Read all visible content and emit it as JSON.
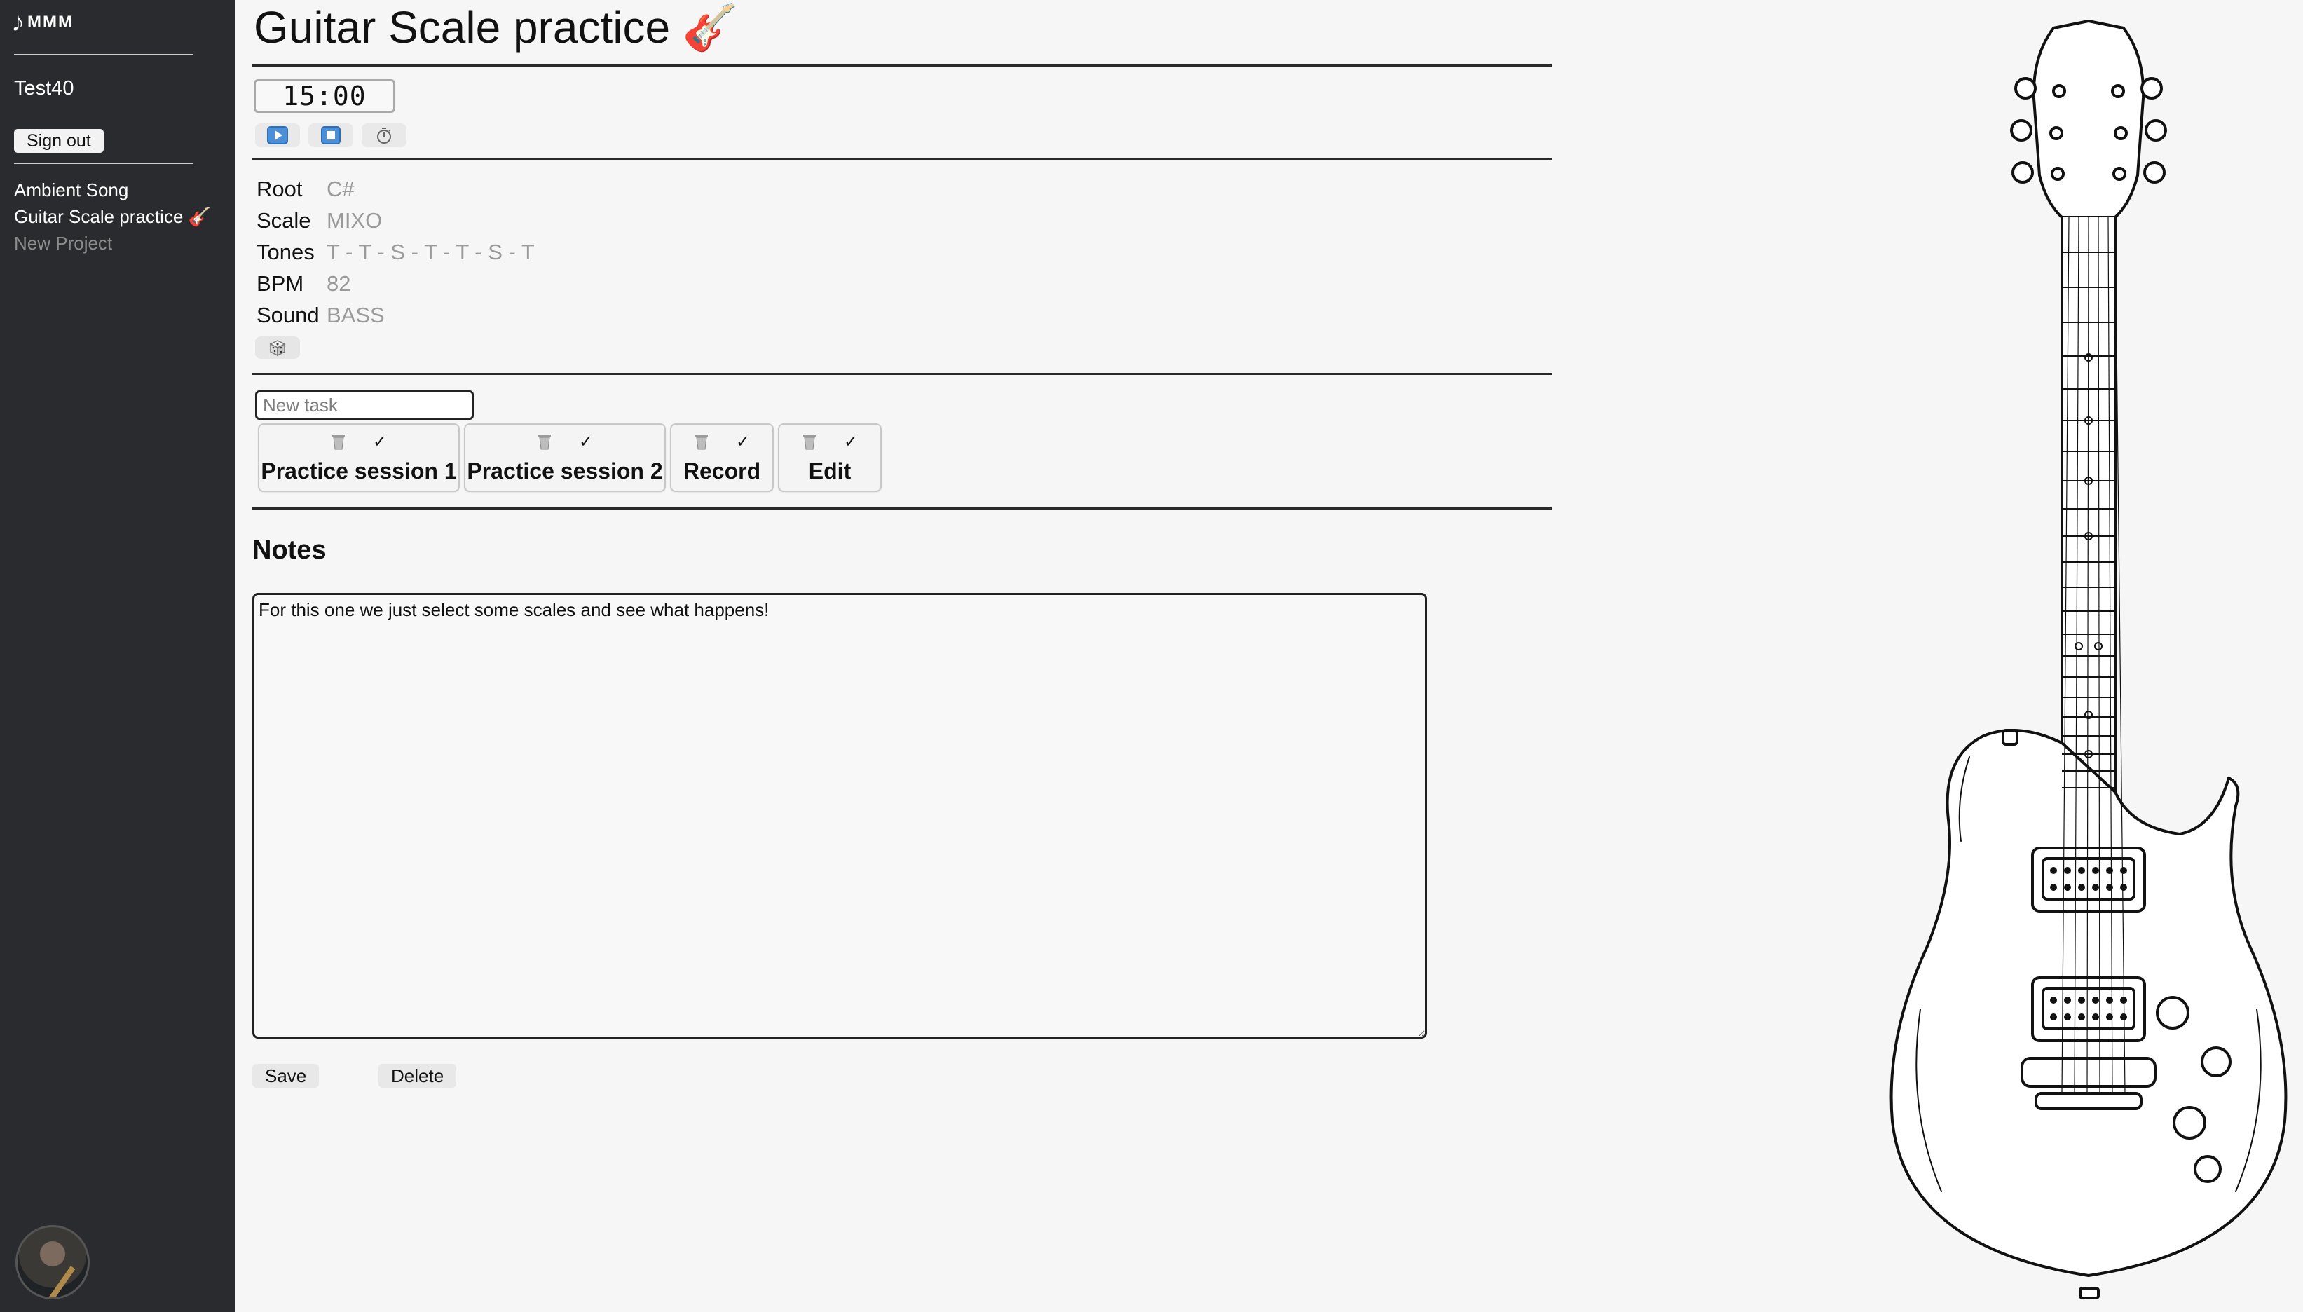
{
  "sidebar": {
    "logo_note": "♪",
    "logo_text": "MMM",
    "username": "Test40",
    "sign_out_label": "Sign out",
    "projects": [
      {
        "label": "Ambient Song"
      },
      {
        "label": "Guitar Scale practice 🎸"
      },
      {
        "label": "New Project"
      }
    ]
  },
  "main": {
    "title": "Guitar Scale practice 🎸",
    "timer": {
      "display": "15:00",
      "icons": [
        "play-icon",
        "stop-icon",
        "stopwatch-icon"
      ]
    },
    "fields": [
      {
        "label": "Root",
        "value": "C#"
      },
      {
        "label": "Scale",
        "value": "MIXO"
      },
      {
        "label": "Tones",
        "value": "T - T - S - T - T - S - T"
      },
      {
        "label": "BPM",
        "value": "82"
      },
      {
        "label": "Sound",
        "value": "BASS"
      }
    ],
    "dice_icon": "dice-icon",
    "new_task_placeholder": "New task",
    "tasks": [
      {
        "name": "Practice session 1"
      },
      {
        "name": "Practice session 2"
      },
      {
        "name": "Record"
      },
      {
        "name": "Edit"
      }
    ],
    "task_check_glyph": "✓",
    "notes_heading": "Notes",
    "notes_text": "For this one we just select some scales and see what happens!",
    "save_label": "Save",
    "delete_label": "Delete"
  },
  "colors": {
    "sidebar_bg": "#2a2b2f",
    "page_bg": "#f6f6f6",
    "muted_value": "#9a9a9a",
    "play_blue": "#4a8fd8"
  }
}
